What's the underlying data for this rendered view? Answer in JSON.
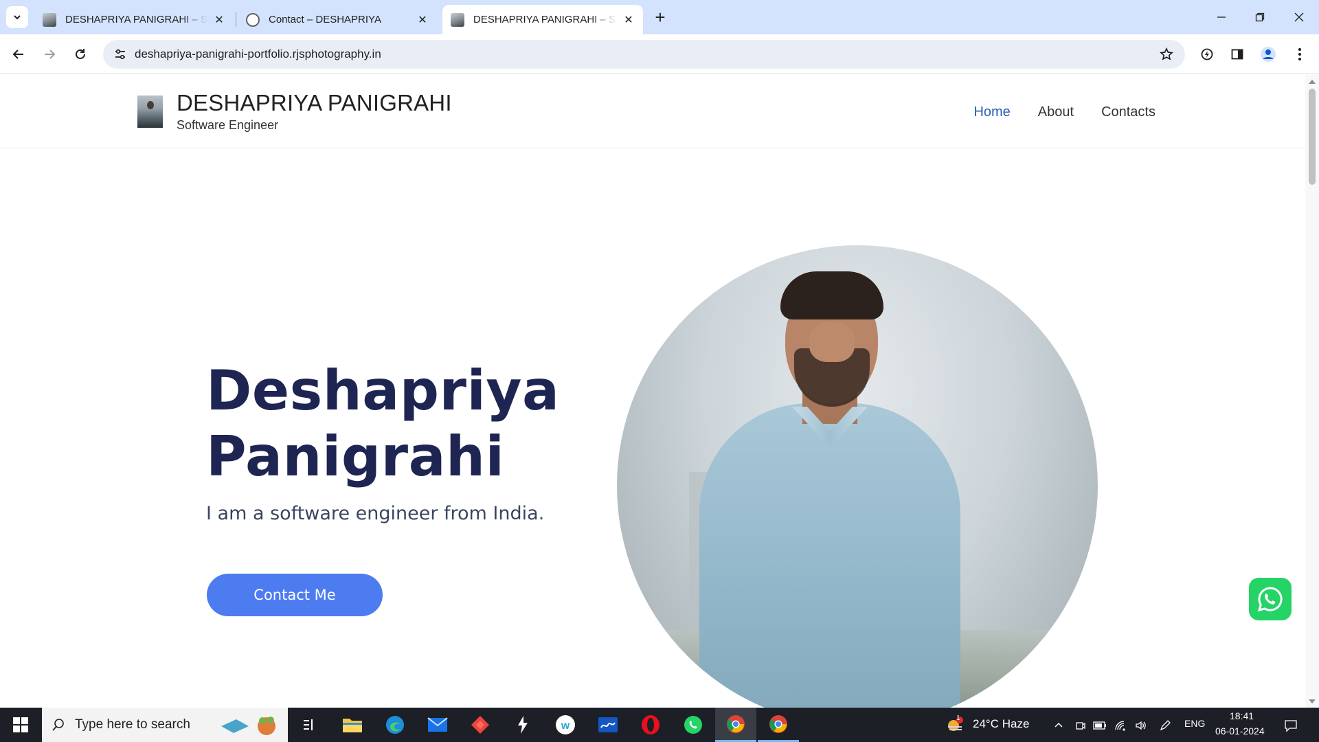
{
  "browser": {
    "tabs": [
      {
        "title": "DESHAPRIYA PANIGRAHI – Soft",
        "favicon": "profile-photo-favicon",
        "active": false
      },
      {
        "title": "Contact – DESHAPRIYA",
        "favicon": "globe-icon",
        "active": false
      },
      {
        "title": "DESHAPRIYA PANIGRAHI – Soft",
        "favicon": "profile-photo-favicon",
        "active": true
      }
    ],
    "new_tab": "+",
    "url": "deshapriya-panigrahi-portfolio.rjsphotography.in",
    "accent": "#d3e3fd"
  },
  "site": {
    "title": "DESHAPRIYA PANIGRAHI",
    "tagline": "Software Engineer",
    "menu": [
      "Home",
      "About",
      "Contacts"
    ],
    "active_menu": "Home",
    "link_color": "#2a5db0"
  },
  "hero": {
    "name_line1": "Deshapriya",
    "name_line2": "Panigrahi",
    "subtitle": "I am a software engineer from India.",
    "cta": "Contact Me",
    "cta_color": "#4d7cf0",
    "heading_color": "#1e2552"
  },
  "taskbar": {
    "search_placeholder": "Type here to search",
    "weather": "24°C  Haze",
    "weather_badge": "1",
    "language": "ENG",
    "time": "18:41",
    "date": "06-01-2024"
  }
}
